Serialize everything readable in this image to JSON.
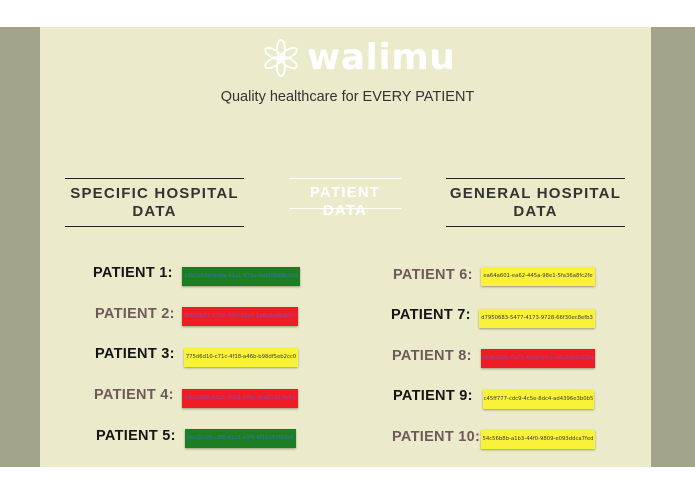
{
  "brand": {
    "name": "walimu",
    "logo_icon": "flower-icon"
  },
  "tagline": "Quality healthcare for EVERY PATIENT",
  "tabs": {
    "specific": "SPECIFIC HOSPITAL DATA",
    "patient": "PATIENT DATA",
    "general": "GENERAL HOSPITAL DATA"
  },
  "colors": {
    "frame": "#a3a38b",
    "panel": "#ebebcb",
    "green": "#1b7e22",
    "red": "#ef1c26",
    "yellow": "#f9f238"
  },
  "left_patients": [
    {
      "label": "PATIENT 1:",
      "id": "c1b7e19d-6e8a-41a1-875e-9a6f08d8b2e0",
      "status": "green"
    },
    {
      "label": "PATIENT 2:",
      "id": "8f293b81-3758-48bf-82c3-1a6a3e08db1c",
      "status": "red"
    },
    {
      "label": "PATIENT 3:",
      "id": "775d6d10-c71c-4f18-a46b-b98df5eb2cc0",
      "status": "yellow"
    },
    {
      "label": "PATIENT 4:",
      "id": "b4b70f08-6325-4659-87bc-9ca819d7fe5a",
      "status": "red"
    },
    {
      "label": "PATIENT 5:",
      "id": "9ec2b1f6-c3f0-41c5-a3f9-4f18d57f93a6",
      "status": "green"
    }
  ],
  "right_patients": [
    {
      "label": "PATIENT 6:",
      "id": "ea64a601-ea62-445a-98e1-5fa36a8fc2fe",
      "status": "yellow"
    },
    {
      "label": "PATIENT 7:",
      "id": "d7950683-5477-4173-9728-66f30ec8efb3",
      "status": "yellow"
    },
    {
      "label": "PATIENT 8:",
      "id": "c8db7b8b-0a79-4b00-b4cc-a8e50d07f38e",
      "status": "red"
    },
    {
      "label": "PATIENT 9:",
      "id": "c45ff777-cdc9-4c5e-8dc4-ad4396e3b0b5",
      "status": "yellow"
    },
    {
      "label": "PATIENT 10:",
      "id": "54c56b8b-a1b3-44f0-9809-e093ddca7fed",
      "status": "yellow"
    }
  ]
}
